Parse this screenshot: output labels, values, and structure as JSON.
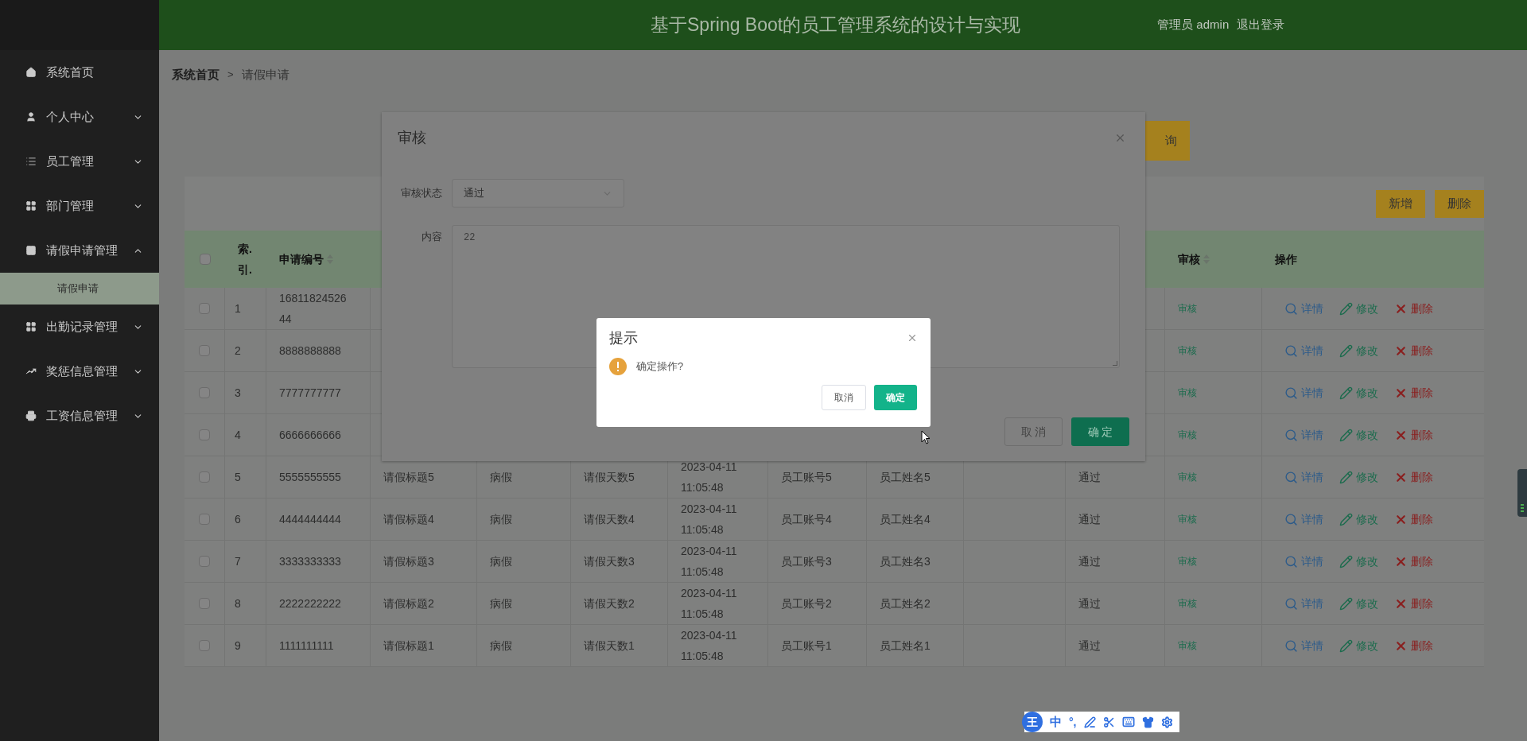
{
  "header": {
    "title": "基于Spring Boot的员工管理系统的设计与实现",
    "user": "管理员 admin",
    "logout": "退出登录"
  },
  "sidebar": {
    "items": [
      {
        "kind": "link",
        "label": "系统首页"
      },
      {
        "kind": "menu",
        "label": "个人中心",
        "expanded": false
      },
      {
        "kind": "menu",
        "label": "员工管理",
        "expanded": false
      },
      {
        "kind": "menu",
        "label": "部门管理",
        "expanded": false
      },
      {
        "kind": "menu",
        "label": "请假申请管理",
        "expanded": true,
        "children": [
          {
            "label": "请假申请",
            "selected": true
          }
        ]
      },
      {
        "kind": "menu",
        "label": "出勤记录管理",
        "expanded": false
      },
      {
        "kind": "menu",
        "label": "奖惩信息管理",
        "expanded": false
      },
      {
        "kind": "menu",
        "label": "工资信息管理",
        "expanded": false
      }
    ]
  },
  "breadcrumb": {
    "items": [
      "系统首页",
      "请假申请"
    ],
    "separator": ">"
  },
  "search_button": "询",
  "toolbar": [
    "新增",
    "删除"
  ],
  "table": {
    "columns": [
      {
        "kind": "checkbox",
        "checked": false
      },
      {
        "kind": "text",
        "label": "索.引."
      },
      {
        "kind": "text",
        "label": "申请编号",
        "sortable": true
      },
      {
        "kind": "covered"
      },
      {
        "kind": "covered"
      },
      {
        "kind": "covered"
      },
      {
        "kind": "covered"
      },
      {
        "kind": "covered"
      },
      {
        "kind": "covered"
      },
      {
        "kind": "covered"
      },
      {
        "kind": "covered"
      },
      {
        "kind": "text",
        "label": "审核",
        "sortable": true
      },
      {
        "kind": "text",
        "label": "操作"
      }
    ],
    "rows": [
      {
        "checked": false,
        "index": "1",
        "number": "1681182452644",
        "audit": "审核",
        "actions": [
          "详情",
          "修改",
          "删除"
        ]
      },
      {
        "checked": false,
        "index": "2",
        "number": "8888888888",
        "audit": "审核",
        "actions": [
          "详情",
          "修改",
          "删除"
        ]
      },
      {
        "checked": false,
        "index": "3",
        "number": "7777777777",
        "audit": "审核",
        "actions": [
          "详情",
          "修改",
          "删除"
        ]
      },
      {
        "checked": false,
        "index": "4",
        "number": "6666666666",
        "audit": "审核",
        "actions": [
          "详情",
          "修改",
          "删除"
        ]
      },
      {
        "checked": false,
        "index": "5",
        "number": "5555555555",
        "title": "请假标题5",
        "type": "病假",
        "days": "请假天数5",
        "time": "2023-04-11 11:05:48",
        "account": "员工账号5",
        "name": "员工姓名5",
        "status": "通过",
        "audit": "审核",
        "actions": [
          "详情",
          "修改",
          "删除"
        ]
      },
      {
        "checked": false,
        "index": "6",
        "number": "4444444444",
        "title": "请假标题4",
        "type": "病假",
        "days": "请假天数4",
        "time": "2023-04-11 11:05:48",
        "account": "员工账号4",
        "name": "员工姓名4",
        "status": "通过",
        "audit": "审核",
        "actions": [
          "详情",
          "修改",
          "删除"
        ]
      },
      {
        "checked": false,
        "index": "7",
        "number": "3333333333",
        "title": "请假标题3",
        "type": "病假",
        "days": "请假天数3",
        "time": "2023-04-11 11:05:48",
        "account": "员工账号3",
        "name": "员工姓名3",
        "status": "通过",
        "audit": "审核",
        "actions": [
          "详情",
          "修改",
          "删除"
        ]
      },
      {
        "checked": false,
        "index": "8",
        "number": "2222222222",
        "title": "请假标题2",
        "type": "病假",
        "days": "请假天数2",
        "time": "2023-04-11 11:05:48",
        "account": "员工账号2",
        "name": "员工姓名2",
        "status": "通过",
        "audit": "审核",
        "actions": [
          "详情",
          "修改",
          "删除"
        ]
      },
      {
        "checked": false,
        "index": "9",
        "number": "1111111111",
        "title": "请假标题1",
        "type": "病假",
        "days": "请假天数1",
        "time": "2023-04-11 11:05:48",
        "account": "员工账号1",
        "name": "员工姓名1",
        "status": "通过",
        "audit": "审核",
        "actions": [
          "详情",
          "修改",
          "删除"
        ]
      }
    ]
  },
  "audit_dialog": {
    "title": "审核",
    "fields": [
      {
        "kind": "select",
        "label": "审核状态",
        "value": "通过"
      },
      {
        "kind": "textarea",
        "label": "内容",
        "value": "22"
      }
    ],
    "buttons": [
      {
        "kind": "cancel",
        "label": "取 消"
      },
      {
        "kind": "primary",
        "label": "确 定"
      }
    ]
  },
  "confirm_dialog": {
    "title": "提示",
    "message": "确定操作?",
    "buttons": [
      {
        "kind": "cancel",
        "label": "取消"
      },
      {
        "kind": "primary",
        "label": "确定"
      }
    ]
  },
  "ime_toolbar": {
    "logo": "王",
    "mode": "中",
    "punctuation": "°,"
  }
}
